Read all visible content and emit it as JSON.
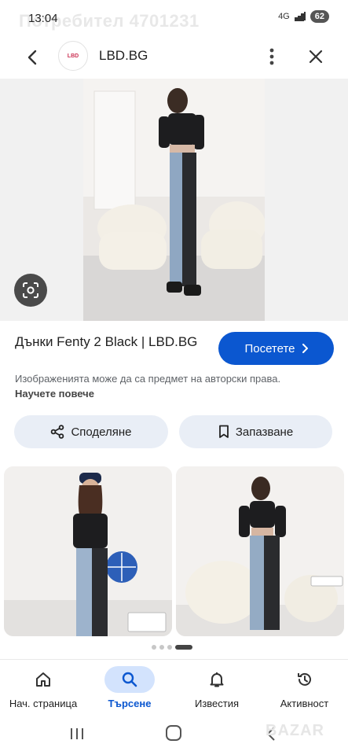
{
  "status_bar": {
    "time": "13:04",
    "watermark": "Потребител 4701231",
    "network": "4G",
    "battery": "62"
  },
  "header": {
    "site_logo_text": "LBD",
    "site_name": "LBD.BG"
  },
  "result": {
    "title": "Дънки Fenty 2 Black | LBD.BG",
    "visit_label": "Посетете",
    "copyright_text": "Изображенията може да са предмет на авторски права.",
    "learn_more": "Научете повече",
    "share_label": "Споделяне",
    "save_label": "Запазване"
  },
  "bottom_nav": {
    "items": [
      {
        "label": "Нач. страница",
        "icon": "home-icon"
      },
      {
        "label": "Търсене",
        "icon": "search-icon",
        "active": true
      },
      {
        "label": "Известия",
        "icon": "bell-icon"
      },
      {
        "label": "Активност",
        "icon": "history-icon"
      }
    ]
  },
  "watermark_bottom": "BAZAR",
  "colors": {
    "accent": "#0b57d0",
    "pill_bg": "#e9eef6",
    "active_nav_bg": "#d3e3fd"
  }
}
